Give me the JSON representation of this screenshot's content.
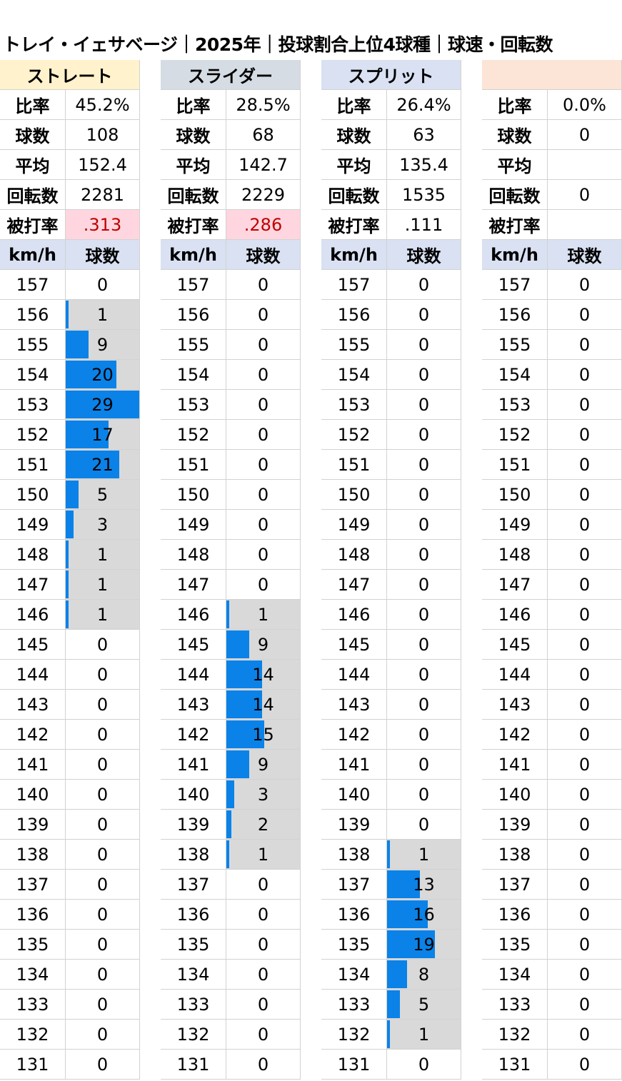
{
  "title": "トレイ・イェサベージ｜2025年｜投球割合上位4球種｜球速・回転数",
  "colors": {
    "bar": "#0a82e8",
    "bar_track": "#d9d9d9",
    "highlight_pink": "#ffd6df",
    "subheader_bg": "#d9e1f2",
    "header_straight": "#fff2cc",
    "header_slider": "#d6dce4",
    "header_split": "#d9e1f2",
    "header_fourth": "#fce4d6",
    "value_red": "#c00000"
  },
  "stat_labels": [
    "比率",
    "球数",
    "平均",
    "回転数",
    "被打率"
  ],
  "sub_headers": {
    "speed": "km/h",
    "count": "球数"
  },
  "speeds": [
    157,
    156,
    155,
    154,
    153,
    152,
    151,
    150,
    149,
    148,
    147,
    146,
    145,
    144,
    143,
    142,
    141,
    140,
    139,
    138,
    137,
    136,
    135,
    134,
    133,
    132,
    131
  ],
  "pitches": [
    {
      "name": "ストレート",
      "header_color": "#fff2cc",
      "stats": [
        "45.2%",
        "108",
        "152.4",
        "2281",
        ".313"
      ],
      "avg_highlight": true,
      "max_count": 29,
      "counts": [
        0,
        1,
        9,
        20,
        29,
        17,
        21,
        5,
        3,
        1,
        1,
        1,
        0,
        0,
        0,
        0,
        0,
        0,
        0,
        0,
        0,
        0,
        0,
        0,
        0,
        0,
        0
      ],
      "bar_range": [
        1,
        11
      ]
    },
    {
      "name": "スライダー",
      "header_color": "#d6dce4",
      "stats": [
        "28.5%",
        "68",
        "142.7",
        "2229",
        ".286"
      ],
      "avg_highlight": true,
      "max_count": 29,
      "counts": [
        0,
        0,
        0,
        0,
        0,
        0,
        0,
        0,
        0,
        0,
        0,
        1,
        9,
        14,
        14,
        15,
        9,
        3,
        2,
        1,
        0,
        0,
        0,
        0,
        0,
        0,
        0
      ],
      "bar_range": [
        11,
        19
      ]
    },
    {
      "name": "スプリット",
      "header_color": "#d9e1f2",
      "stats": [
        "26.4%",
        "63",
        "135.4",
        "1535",
        ".111"
      ],
      "avg_highlight": false,
      "max_count": 29,
      "counts": [
        0,
        0,
        0,
        0,
        0,
        0,
        0,
        0,
        0,
        0,
        0,
        0,
        0,
        0,
        0,
        0,
        0,
        0,
        0,
        1,
        13,
        16,
        19,
        8,
        5,
        1,
        0
      ],
      "bar_range": [
        19,
        25
      ]
    },
    {
      "name": "",
      "header_color": "#fce4d6",
      "stats": [
        "0.0%",
        "0",
        "",
        "0",
        ""
      ],
      "avg_highlight": false,
      "max_count": 29,
      "counts": [
        0,
        0,
        0,
        0,
        0,
        0,
        0,
        0,
        0,
        0,
        0,
        0,
        0,
        0,
        0,
        0,
        0,
        0,
        0,
        0,
        0,
        0,
        0,
        0,
        0,
        0,
        0
      ],
      "bar_range": null
    }
  ]
}
